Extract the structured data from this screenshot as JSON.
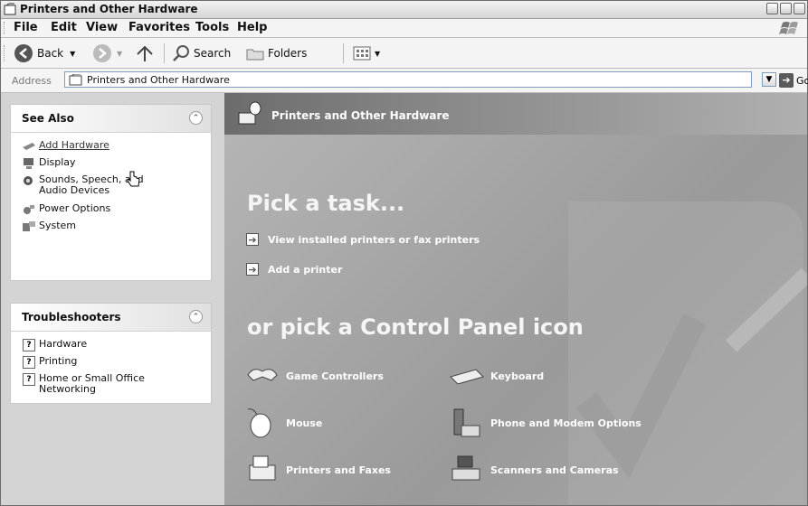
{
  "window": {
    "title": "Printers and Other Hardware"
  },
  "menu": [
    "File",
    "Edit",
    "View",
    "Favorites",
    "Tools",
    "Help"
  ],
  "toolbar": {
    "back": "Back",
    "search": "Search",
    "folders": "Folders"
  },
  "address": {
    "label": "Address",
    "value": "Printers and Other Hardware",
    "go": "Go"
  },
  "see_also": {
    "title": "See Also",
    "items": [
      {
        "label": "Add Hardware",
        "icon": "add-hardware-icon"
      },
      {
        "label": "Display",
        "icon": "display-icon"
      },
      {
        "label": "Sounds, Speech, and Audio Devices",
        "icon": "sounds-icon"
      },
      {
        "label": "Power Options",
        "icon": "power-options-icon"
      },
      {
        "label": "System",
        "icon": "system-icon"
      }
    ]
  },
  "troubleshooters": {
    "title": "Troubleshooters",
    "items": [
      {
        "label": "Hardware"
      },
      {
        "label": "Printing"
      },
      {
        "label": "Home or Small Office Networking"
      }
    ]
  },
  "main": {
    "header": "Printers and Other Hardware",
    "pick_task": "Pick a task...",
    "tasks": [
      "View installed printers or fax printers",
      "Add a printer"
    ],
    "pick_icon": "or pick a Control Panel icon",
    "icons": [
      {
        "label": "Game Controllers",
        "icon": "game-controller-icon"
      },
      {
        "label": "Keyboard",
        "icon": "keyboard-icon"
      },
      {
        "label": "Mouse",
        "icon": "mouse-icon"
      },
      {
        "label": "Phone and Modem Options",
        "icon": "phone-modem-icon"
      },
      {
        "label": "Printers and Faxes",
        "icon": "printer-fax-icon"
      },
      {
        "label": "Scanners and Cameras",
        "icon": "scanner-camera-icon"
      }
    ]
  }
}
